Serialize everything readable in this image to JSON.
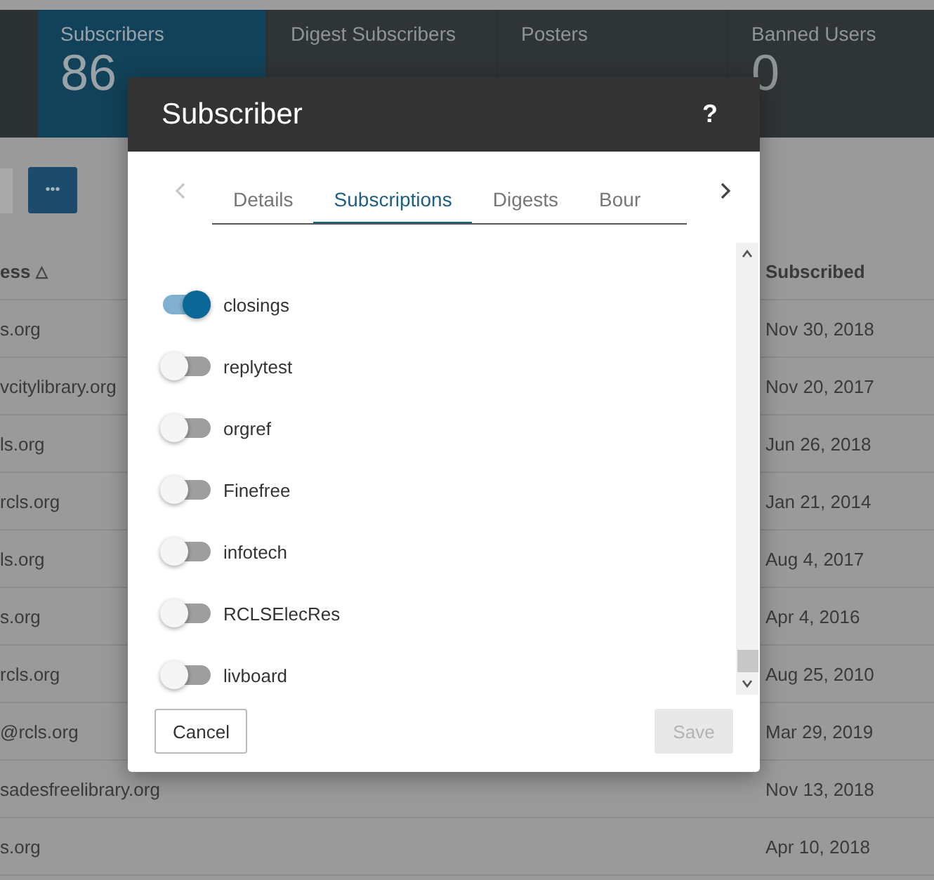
{
  "stats": [
    {
      "label": "Subscribers",
      "value": "86",
      "selected": true
    },
    {
      "label": "Digest Subscribers",
      "selected": false
    },
    {
      "label": "Posters",
      "selected": false
    },
    {
      "label": "Banned Users",
      "value": "0",
      "selected": false
    }
  ],
  "toolbar": {
    "more_button": "•••"
  },
  "table": {
    "columns": [
      {
        "label": "ess",
        "sort_indicator": "△"
      },
      {
        "label": "Subscribed"
      }
    ],
    "rows": [
      {
        "address": "s.org",
        "subscribed": "Nov 30, 2018"
      },
      {
        "address": "vcitylibrary.org",
        "subscribed": "Nov 20, 2017"
      },
      {
        "address": "ls.org",
        "subscribed": "Jun 26, 2018"
      },
      {
        "address": "rcls.org",
        "subscribed": "Jan 21, 2014"
      },
      {
        "address": "ls.org",
        "subscribed": "Aug 4, 2017"
      },
      {
        "address": "s.org",
        "subscribed": "Apr 4, 2016"
      },
      {
        "address": "rcls.org",
        "subscribed": "Aug 25, 2010"
      },
      {
        "address": "@rcls.org",
        "subscribed": "Mar 29, 2019"
      },
      {
        "address": "sadesfreelibrary.org",
        "subscribed": "Nov 13, 2018"
      },
      {
        "address": "s.org",
        "subscribed": "Apr 10, 2018"
      }
    ]
  },
  "dialog": {
    "title": "Subscriber",
    "help": "?",
    "tabs": [
      {
        "label": "Details",
        "selected": false
      },
      {
        "label": "Subscriptions",
        "selected": true
      },
      {
        "label": "Digests",
        "selected": false
      },
      {
        "label": "Bour",
        "selected": false
      }
    ],
    "subscriptions": [
      {
        "name": "closings",
        "on": true
      },
      {
        "name": "replytest",
        "on": false
      },
      {
        "name": "orgref",
        "on": false
      },
      {
        "name": "Finefree",
        "on": false
      },
      {
        "name": "infotech",
        "on": false
      },
      {
        "name": "RCLSElecRes",
        "on": false
      },
      {
        "name": "livboard",
        "on": false
      }
    ],
    "cancel_button": "Cancel",
    "save_button": {
      "label": "Save",
      "disabled": true
    }
  }
}
